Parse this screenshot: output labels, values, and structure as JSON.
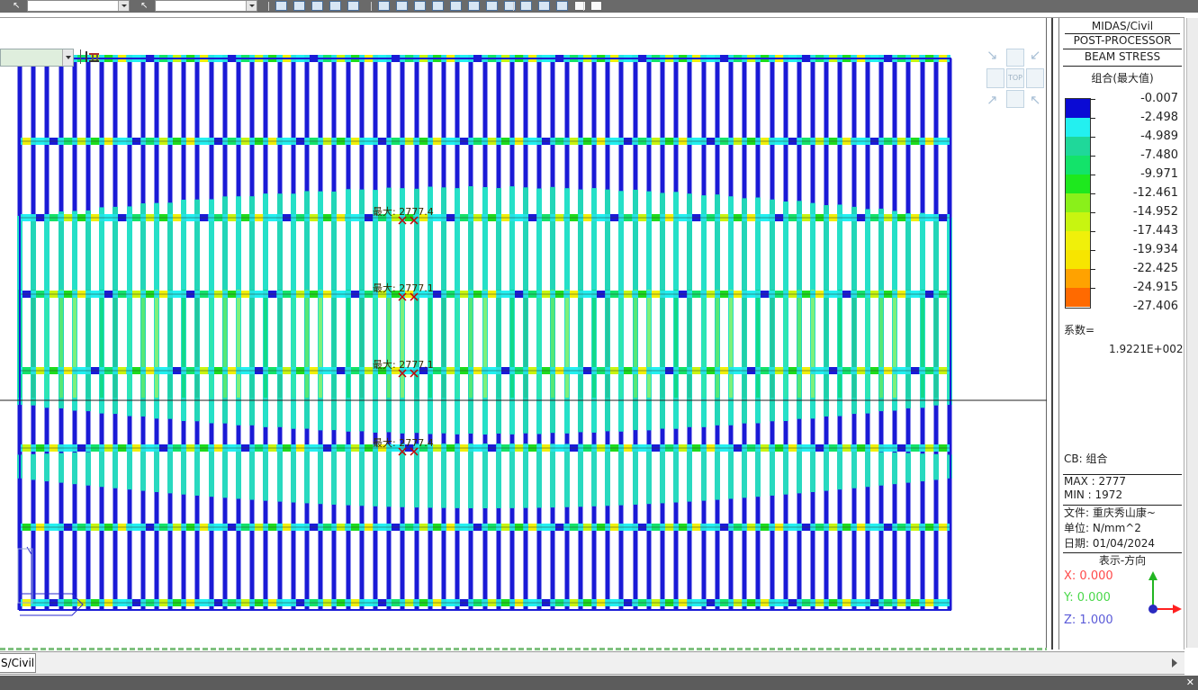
{
  "toolbar": {
    "icons": [
      "select-arrow-icon",
      "select-arrow-icon",
      "zoom-window-icon",
      "zoom-fit-icon",
      "line-icon",
      "play-icon",
      "print-icon",
      "rotate-icon",
      "frame-icon",
      "undo-icon",
      "display-icon",
      "view-icon",
      "view-icon",
      "node-icon",
      "element-icon",
      "copy-icon",
      "grid-icon",
      "window-icon"
    ]
  },
  "viewport": {
    "group_combo_value": "",
    "view_cube_label": "TOP",
    "max_markers": [
      {
        "label": "最大: 2777.4"
      },
      {
        "label": "最大: 2777.1"
      },
      {
        "label": "最大: 2777.1"
      },
      {
        "label": "最大: 2777.4"
      }
    ]
  },
  "legend": {
    "program": "MIDAS/Civil",
    "mode": "POST-PROCESSOR",
    "result_type": "BEAM STRESS",
    "combination_header": "组合(最大值)",
    "scale_values": [
      "-0.007",
      "-2.498",
      "-4.989",
      "-7.480",
      "-9.971",
      "-12.461",
      "-14.952",
      "-17.443",
      "-19.934",
      "-22.425",
      "-24.915",
      "-27.406"
    ],
    "scale_colors": [
      "#0a0ad4",
      "#23f0f0",
      "#1fd89a",
      "#13e36a",
      "#1ee81e",
      "#8af01a",
      "#c8f510",
      "#f0f00a",
      "#f7e500",
      "#ffa200",
      "#ff6a00",
      "#ff2a00"
    ],
    "factor_label": "系数=",
    "factor_value": "1.9221E+002",
    "cb_label": "CB: 组合",
    "max_label": "MAX : 2777",
    "min_label": "MIN : 1972",
    "file_label": "文件: 重庆秀山康~",
    "unit_label": "单位: N/mm^2",
    "date_label": "日期: 01/04/2024",
    "view_direction_label": "表示-方向",
    "x_label": "X: 0.000",
    "y_label": "Y: 0.000",
    "z_label": "Z: 1.000",
    "colors": {
      "x": "#ff4a4a",
      "y": "#4ad84a",
      "z": "#5a5ad8"
    }
  },
  "tabs": {
    "active_tab": "S/Civil"
  }
}
